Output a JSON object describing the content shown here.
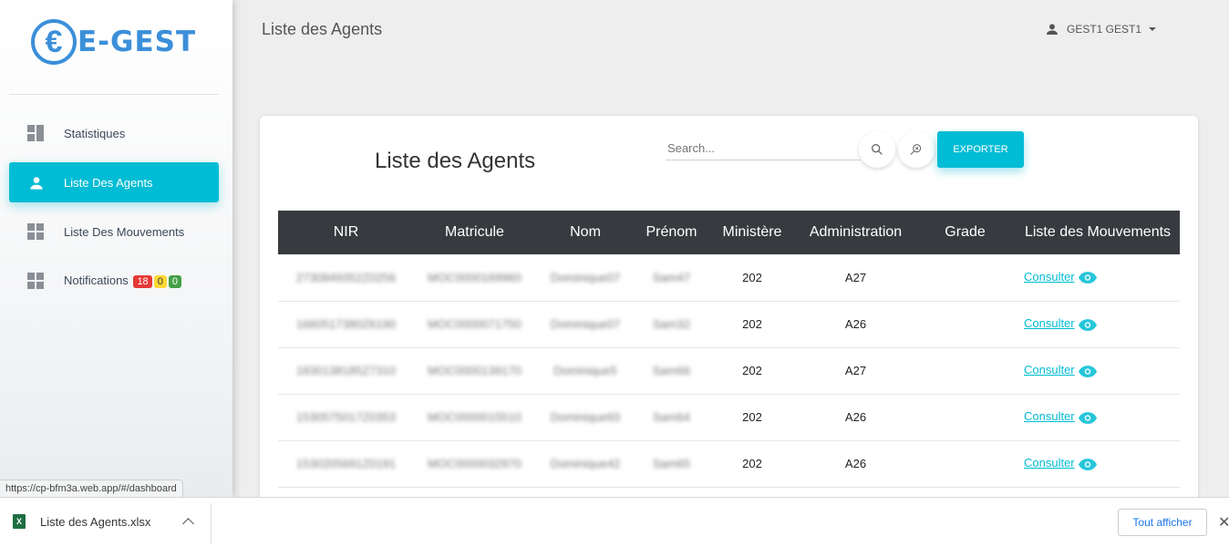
{
  "app": {
    "logo_symbol": "€",
    "logo_text": "E-GEST",
    "brand_color": "#3b8fd9",
    "accent_color": "#00bcd4"
  },
  "sidebar": {
    "items": [
      {
        "label": "Statistiques",
        "icon": "dashboard-icon"
      },
      {
        "label": "Liste Des Agents",
        "icon": "person-icon",
        "active": true
      },
      {
        "label": "Liste Des Mouvements",
        "icon": "dashboard-icon"
      },
      {
        "label": "Notifications",
        "icon": "dashboard-icon",
        "badges": [
          "18",
          "0",
          "0"
        ]
      }
    ]
  },
  "status_url": "https://cp-bfm3a.web.app/#/dashboard",
  "header": {
    "title": "Liste des Agents",
    "user": "GEST1 GEST1"
  },
  "card": {
    "title": "Liste des Agents",
    "search_placeholder": "Search...",
    "export_label": "EXPORTER"
  },
  "table": {
    "columns": [
      "NIR",
      "Matricule",
      "Nom",
      "Prénom",
      "Ministère",
      "Administration",
      "Grade",
      "Liste des Mouvements"
    ],
    "rows": [
      {
        "nir": "2730849352Z0256",
        "matricule": "MOC0000169960",
        "nom": "Dominique07",
        "prenom": "Sam47",
        "ministere": "202",
        "administration": "A27",
        "grade": "",
        "link": "Consulter"
      },
      {
        "nir": "1660517380Z6190",
        "matricule": "MOC0000071750",
        "nom": "Dominique07",
        "prenom": "Sam32",
        "ministere": "202",
        "administration": "A26",
        "grade": "",
        "link": "Consulter"
      },
      {
        "nir": "1830138185Z7310",
        "matricule": "MOC0000139170",
        "nom": "Dominique5",
        "prenom": "Sam66",
        "ministere": "202",
        "administration": "A27",
        "grade": "",
        "link": "Consulter"
      },
      {
        "nir": "1530575017Z0353",
        "matricule": "MOC0000015510",
        "nom": "Dominique93",
        "prenom": "Sam64",
        "ministere": "202",
        "administration": "A26",
        "grade": "",
        "link": "Consulter"
      },
      {
        "nir": "1530205691Z0191",
        "matricule": "MOC0000032970",
        "nom": "Dominique42",
        "prenom": "Sam65",
        "ministere": "202",
        "administration": "A26",
        "grade": "",
        "link": "Consulter"
      }
    ]
  },
  "download_bar": {
    "filename": "Liste des Agents.xlsx",
    "show_all": "Tout afficher"
  }
}
